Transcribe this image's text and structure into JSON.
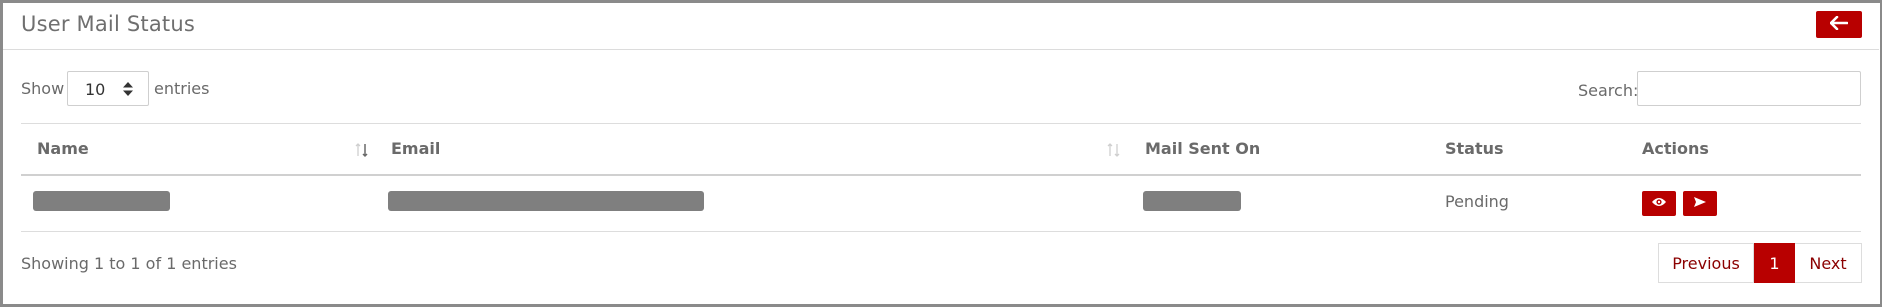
{
  "header": {
    "title": "User Mail Status",
    "back_icon": "arrow-left-icon"
  },
  "length": {
    "prefix": "Show",
    "selected": "10",
    "suffix": "entries"
  },
  "search": {
    "label": "Search:",
    "value": ""
  },
  "table": {
    "columns": [
      "Name",
      "Email",
      "Mail Sent On",
      "Status",
      "Actions"
    ],
    "rows": [
      {
        "name": "",
        "email": "",
        "mail_sent_on": "",
        "status": "Pending",
        "actions": [
          "eye-icon",
          "send-icon"
        ]
      }
    ]
  },
  "info": "Showing 1 to 1 of 1 entries",
  "pagination": {
    "previous": "Previous",
    "current": "1",
    "next": "Next"
  },
  "colors": {
    "accent": "#b80000",
    "link": "#8b0000",
    "redacted": "#7f7f7f"
  }
}
